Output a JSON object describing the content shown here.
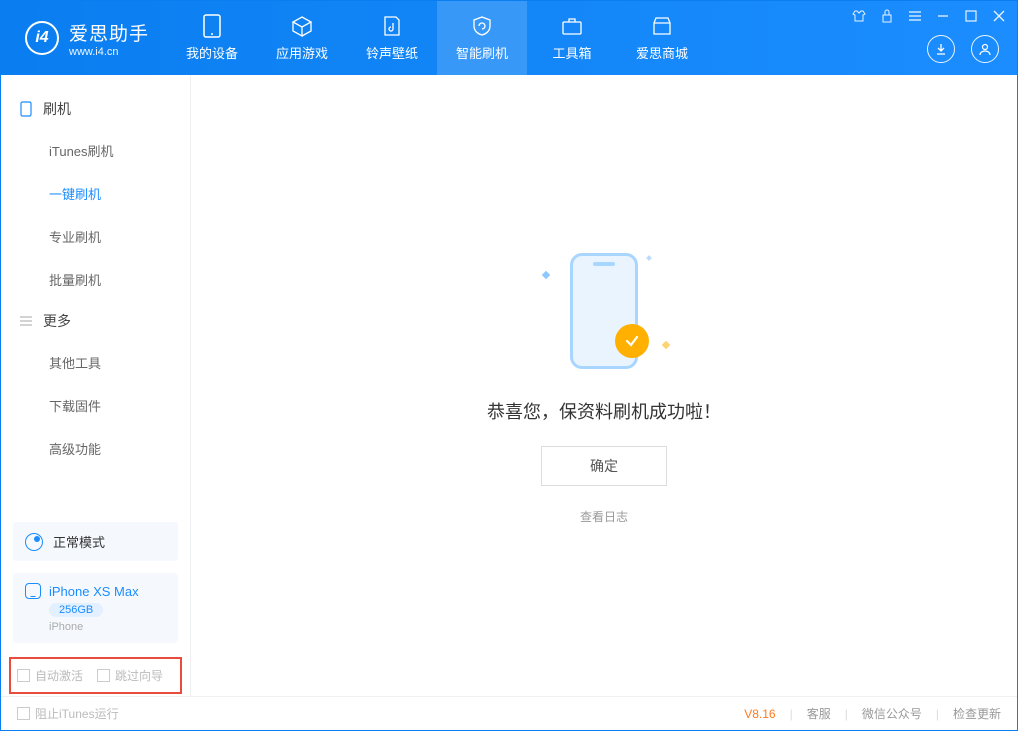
{
  "app": {
    "name_cn": "爱思助手",
    "name_en": "www.i4.cn"
  },
  "tabs": {
    "device": "我的设备",
    "apps": "应用游戏",
    "ring": "铃声壁纸",
    "flash": "智能刷机",
    "tools": "工具箱",
    "store": "爱思商城"
  },
  "sidebar": {
    "sec_flash": "刷机",
    "items_flash": {
      "itunes": "iTunes刷机",
      "oneclick": "一键刷机",
      "pro": "专业刷机",
      "batch": "批量刷机"
    },
    "sec_more": "更多",
    "items_more": {
      "other": "其他工具",
      "firmware": "下载固件",
      "adv": "高级功能"
    }
  },
  "mode": {
    "label": "正常模式"
  },
  "device": {
    "name": "iPhone XS Max",
    "capacity": "256GB",
    "type": "iPhone"
  },
  "checks": {
    "auto_activate": "自动激活",
    "skip_guide": "跳过向导"
  },
  "main": {
    "msg": "恭喜您，保资料刷机成功啦！",
    "ok": "确定",
    "log": "查看日志"
  },
  "footer": {
    "block_itunes": "阻止iTunes运行",
    "version": "V8.16",
    "support": "客服",
    "wechat": "微信公众号",
    "update": "检查更新"
  }
}
